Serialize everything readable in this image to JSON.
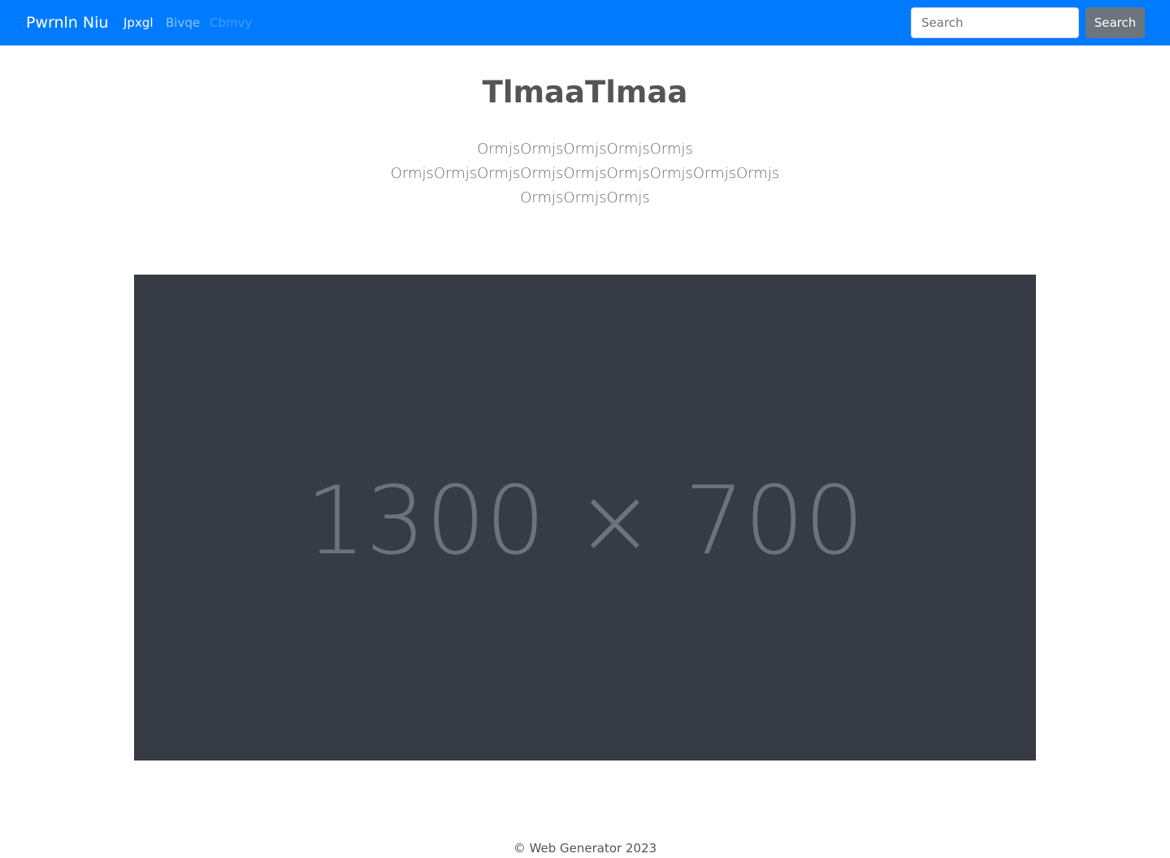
{
  "navbar": {
    "brand": "Pwrnln Niu",
    "links": [
      {
        "label": "Jpxgl",
        "state": "active"
      },
      {
        "label": "Bivqe",
        "state": "normal"
      },
      {
        "label": "Cbmvy",
        "state": "disabled"
      }
    ],
    "search": {
      "placeholder": "Search",
      "button_label": "Search"
    },
    "background_color": "#007bff"
  },
  "main": {
    "title": "TlmaaTlmaa",
    "lead_lines": [
      "OrmjsOrmjsOrmjsOrmjsOrmjs",
      "OrmjsOrmjsOrmjsOrmjsOrmjsOrmjsOrmjsOrmjsOrmjs",
      "OrmjsOrmjsOrmjs"
    ],
    "image": {
      "placeholder_text": "1300 × 700",
      "background_color": "#373b43",
      "text_color": "#6c737d"
    }
  },
  "footer": {
    "text": "© Web Generator 2023"
  }
}
